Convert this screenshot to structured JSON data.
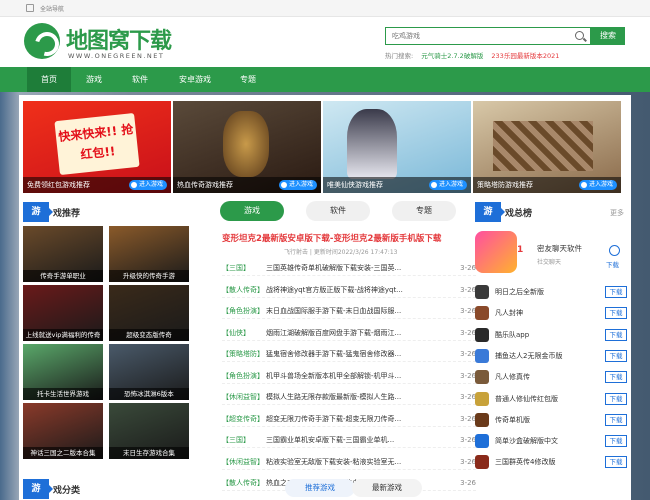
{
  "topbar": {
    "nav_label": "全站导航"
  },
  "brand": {
    "name": "地图窝下载",
    "url_text": "WWW.ONEGREEN.NET"
  },
  "search": {
    "placeholder": "吃鸡游戏",
    "button": "搜索",
    "hot_label": "热门搜索:",
    "hot_keywords": [
      "元气骑士2.7.2破解版",
      "233乐园最新版本2021"
    ]
  },
  "nav": {
    "items": [
      "首页",
      "游戏",
      "软件",
      "安卓游戏",
      "专题"
    ],
    "active": "首页"
  },
  "banners": [
    {
      "title": "免费领红包游戏推荐",
      "action": "进入游戏",
      "text": "快来快来!! 抢红包!!"
    },
    {
      "title": "热血传奇游戏推荐",
      "action": "进入游戏"
    },
    {
      "title": "唯美仙侠游戏推荐",
      "action": "进入游戏"
    },
    {
      "title": "策略塔防游戏推荐",
      "action": "进入游戏"
    }
  ],
  "game_rec": {
    "tag": "游",
    "title": "戏推荐",
    "items": [
      {
        "label": "传奇手游单职业",
        "color": "#6a4a2a"
      },
      {
        "label": "升级快的传奇手游",
        "color": "#8a5a2a"
      },
      {
        "label": "上线就送vip满福利的传奇",
        "color": "#6a1a1a"
      },
      {
        "label": "超级变态版传奇",
        "color": "#3a2a1a"
      },
      {
        "label": "托卡生活世界游戏",
        "color": "#5aa86a"
      },
      {
        "label": "恐怖冰淇淋6版本",
        "color": "#4a5a6a"
      },
      {
        "label": "神话三国之二版本合集",
        "color": "#8a3a2a"
      },
      {
        "label": "末日生存游戏合集",
        "color": "#3a4a3a"
      }
    ]
  },
  "tabs": {
    "items": [
      "游戏",
      "软件",
      "专题"
    ],
    "active": "游戏"
  },
  "headline": {
    "title": "变形坦克2最新版安卓版下载-变形坦克2最新版手机版下载",
    "meta": "飞行射击 | 更新时间2022/3/26 17:47:13"
  },
  "news": [
    {
      "cat": "【三国】",
      "title": "三国英雄传奇单机破解版下载安装-三国英...",
      "date": "3-26"
    },
    {
      "cat": "【散人传奇】",
      "title": "战将神途yqt官方版正版下载-战将神途yqt...",
      "date": "3-26"
    },
    {
      "cat": "【角色扮演】",
      "title": "末日血战国际服手游下载-末日血战国际服...",
      "date": "3-26"
    },
    {
      "cat": "【仙侠】",
      "title": "烟雨江湖破解版百度网盘手游下载-烟雨江...",
      "date": "3-26"
    },
    {
      "cat": "【策略塔防】",
      "title": "猛鬼宿舍修改器手游下载-猛鬼宿舍修改器...",
      "date": "3-26"
    },
    {
      "cat": "【角色扮演】",
      "title": "机甲斗兽场全新版本机甲全部解锁-机甲斗...",
      "date": "3-26"
    },
    {
      "cat": "【休闲益智】",
      "title": "模拟人生路无限存款版最新版-模拟人生路...",
      "date": "3-26"
    },
    {
      "cat": "【超变传奇】",
      "title": "超变无限刀传奇手游下载-超变无限刀传奇...",
      "date": "3-26"
    },
    {
      "cat": "【三国】",
      "title": "三国霸业单机安卓版下载-三国霸业单机...",
      "date": "3-26"
    },
    {
      "cat": "【休闲益智】",
      "title": "粘液实验室无敌版下载安装-粘液实验室无...",
      "date": "3-26"
    },
    {
      "cat": "【散人传奇】",
      "title": "热血之刃手游官方版下载-热血之刃手游官方...",
      "date": "3-26"
    }
  ],
  "ranking": {
    "tag": "游",
    "title": "戏总榜",
    "more": "更多",
    "featured": {
      "rank": "1",
      "name": "密友聊天软件",
      "sub": "社交聊天",
      "action": "下载"
    },
    "items": [
      {
        "name": "明日之后全新版",
        "action": "下载",
        "color": "#3a3a3a"
      },
      {
        "name": "凡人封神",
        "action": "下载",
        "color": "#8a4a2a"
      },
      {
        "name": "酷乐队app",
        "action": "下载",
        "color": "#2a2a2a"
      },
      {
        "name": "捕鱼达人2无限金币版",
        "action": "下载",
        "color": "#3a7ad8"
      },
      {
        "name": "凡人修真传",
        "action": "下载",
        "color": "#7a5a3a"
      },
      {
        "name": "普通人修仙传红包版",
        "action": "下载",
        "color": "#c8a23a"
      },
      {
        "name": "传奇单机版",
        "action": "下载",
        "color": "#6a3a1a"
      },
      {
        "name": "简单沙盒破解版中文",
        "action": "下载",
        "color": "#1e6fd8"
      },
      {
        "name": "三国群英传4修改版",
        "action": "下载",
        "color": "#8a2a1a"
      }
    ]
  },
  "category": {
    "tag": "游",
    "title": "戏分类",
    "pills": [
      "推荐游戏",
      "最新游戏"
    ]
  }
}
